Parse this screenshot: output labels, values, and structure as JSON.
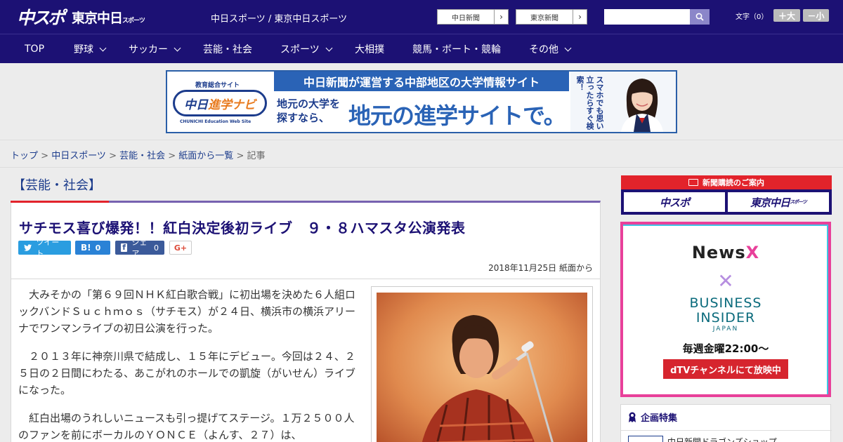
{
  "header": {
    "logo_main": "中スポ",
    "logo_tokyo": "東京中日",
    "logo_tokyo_small": "スポーツ",
    "tagline": "中日スポーツ / 東京中日スポーツ",
    "ext_links": [
      "中日新聞",
      "東京新聞"
    ],
    "search_placeholder": "",
    "font_label": "文字（0）",
    "font_larger": "＋大",
    "font_smaller": "－小"
  },
  "nav": {
    "items": [
      {
        "label": "TOP"
      },
      {
        "label": "野球"
      },
      {
        "label": "サッカー"
      },
      {
        "label": "芸能・社会"
      },
      {
        "label": "スポーツ"
      },
      {
        "label": "大相撲"
      },
      {
        "label": "競馬・ボート・競輪"
      },
      {
        "label": "その他"
      }
    ]
  },
  "banner": {
    "sub": "教育総合サイト",
    "logo_a": "中日",
    "logo_b": "進学ナビ",
    "logo_eng": "CHUNICHI Education Web Site",
    "headline": "中日新聞が運営する中部地区の大学情報サイト",
    "lead": "地元の大学を探すなら、",
    "big": "地元の進学サイトで。",
    "vertical": "スマホでも思い立ったらすぐ検索！"
  },
  "breadcrumb": {
    "items": [
      "トップ",
      "中日スポーツ",
      "芸能・社会",
      "紙面から一覧"
    ],
    "current": "記事",
    "sep": " > "
  },
  "article": {
    "category": "【芸能・社会】",
    "title": "サチモス喜び爆発！！紅白決定後初ライブ　９・８ハマスタ公演発表",
    "share": {
      "tweet": "ツイート",
      "hatena_count": "0",
      "facebook": "シェア",
      "facebook_count": "0",
      "gplus": "G+"
    },
    "date": "2018年11月25日 紙面から",
    "paragraphs": [
      "大みそかの「第６９回ＮＨＫ紅白歌合戦」に初出場を決めた６人組ロックバンドＳｕｃｈｍｏｓ（サチモス）が２４日、横浜市の横浜アリーナでワンマンライブの初日公演を行った。",
      "２０１３年に神奈川県で結成し、１５年にデビュー。今回は２４、２５日の２日間にわたる、あこがれのホールでの凱旋（がいせん）ライブになった。",
      "紅白出場のうれしいニュースも引っ提げてステージ。１万２５００人のファンを前にボーカルのＹＯＮＣＥ（よんす、２７）は、"
    ]
  },
  "sidebar": {
    "subscribe_head": "新聞購読のご案内",
    "sub_btn1": "中スポ",
    "sub_btn2": "東京中日",
    "sub_btn2_small": "スポーツ",
    "ad": {
      "newsx_a": "News",
      "newsx_b": "X",
      "cross": "✕",
      "bi_line1": "BUSINESS",
      "bi_line2": "INSIDER",
      "bi_jp": "JAPAN",
      "weekly": "毎週金曜22:00〜",
      "dtv": "dTVチャンネルにて放映中"
    },
    "kikaku_head": "企画特集",
    "kikaku_item": "中日新聞ドラゴンズショップ"
  },
  "colors": {
    "navy": "#1c1174",
    "accent_red": "#e2232b",
    "accent_purple": "#7762b0",
    "link": "#1c3c8c"
  }
}
